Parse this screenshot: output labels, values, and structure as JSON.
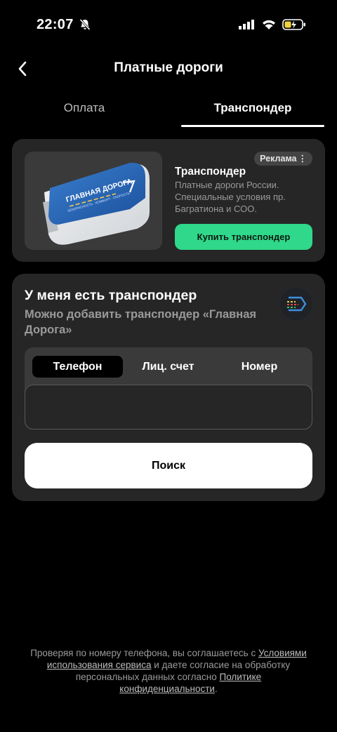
{
  "status_bar": {
    "time": "22:07"
  },
  "header": {
    "title": "Платные дороги"
  },
  "tabs": [
    {
      "label": "Оплата",
      "active": false
    },
    {
      "label": "Транспондер",
      "active": true
    }
  ],
  "ad": {
    "badge": "Реклама",
    "title": "Транспондер",
    "description": "Платные дороги России. Специальные условия пр. Багратиона и СОО.",
    "button": "Купить транспондер",
    "device_brand": "ГЛАВНАЯ ДОРОГА",
    "device_tagline": "БЕЗОПАСНОСТЬ · КОМФОРТ · СКОРОСТЬ"
  },
  "transponder": {
    "title": "У меня есть транспондер",
    "subtitle": "Можно добавить транспондер «Главная Дорога»",
    "segments": [
      {
        "label": "Телефон",
        "active": true
      },
      {
        "label": "Лиц. счет",
        "active": false
      },
      {
        "label": "Номер",
        "active": false
      }
    ],
    "input_value": "",
    "search_button": "Поиск"
  },
  "footer": {
    "text1": "Проверяя по номеру телефона, вы соглашаетесь с ",
    "link1": "Условиями использования сервиса",
    "text2": " и даете согласие на обработку персональных данных согласно ",
    "link2": "Политике конфиденциальности",
    "text3": "."
  },
  "colors": {
    "accent_green": "#2fd88a",
    "card_bg": "#262626",
    "background": "#000000"
  }
}
